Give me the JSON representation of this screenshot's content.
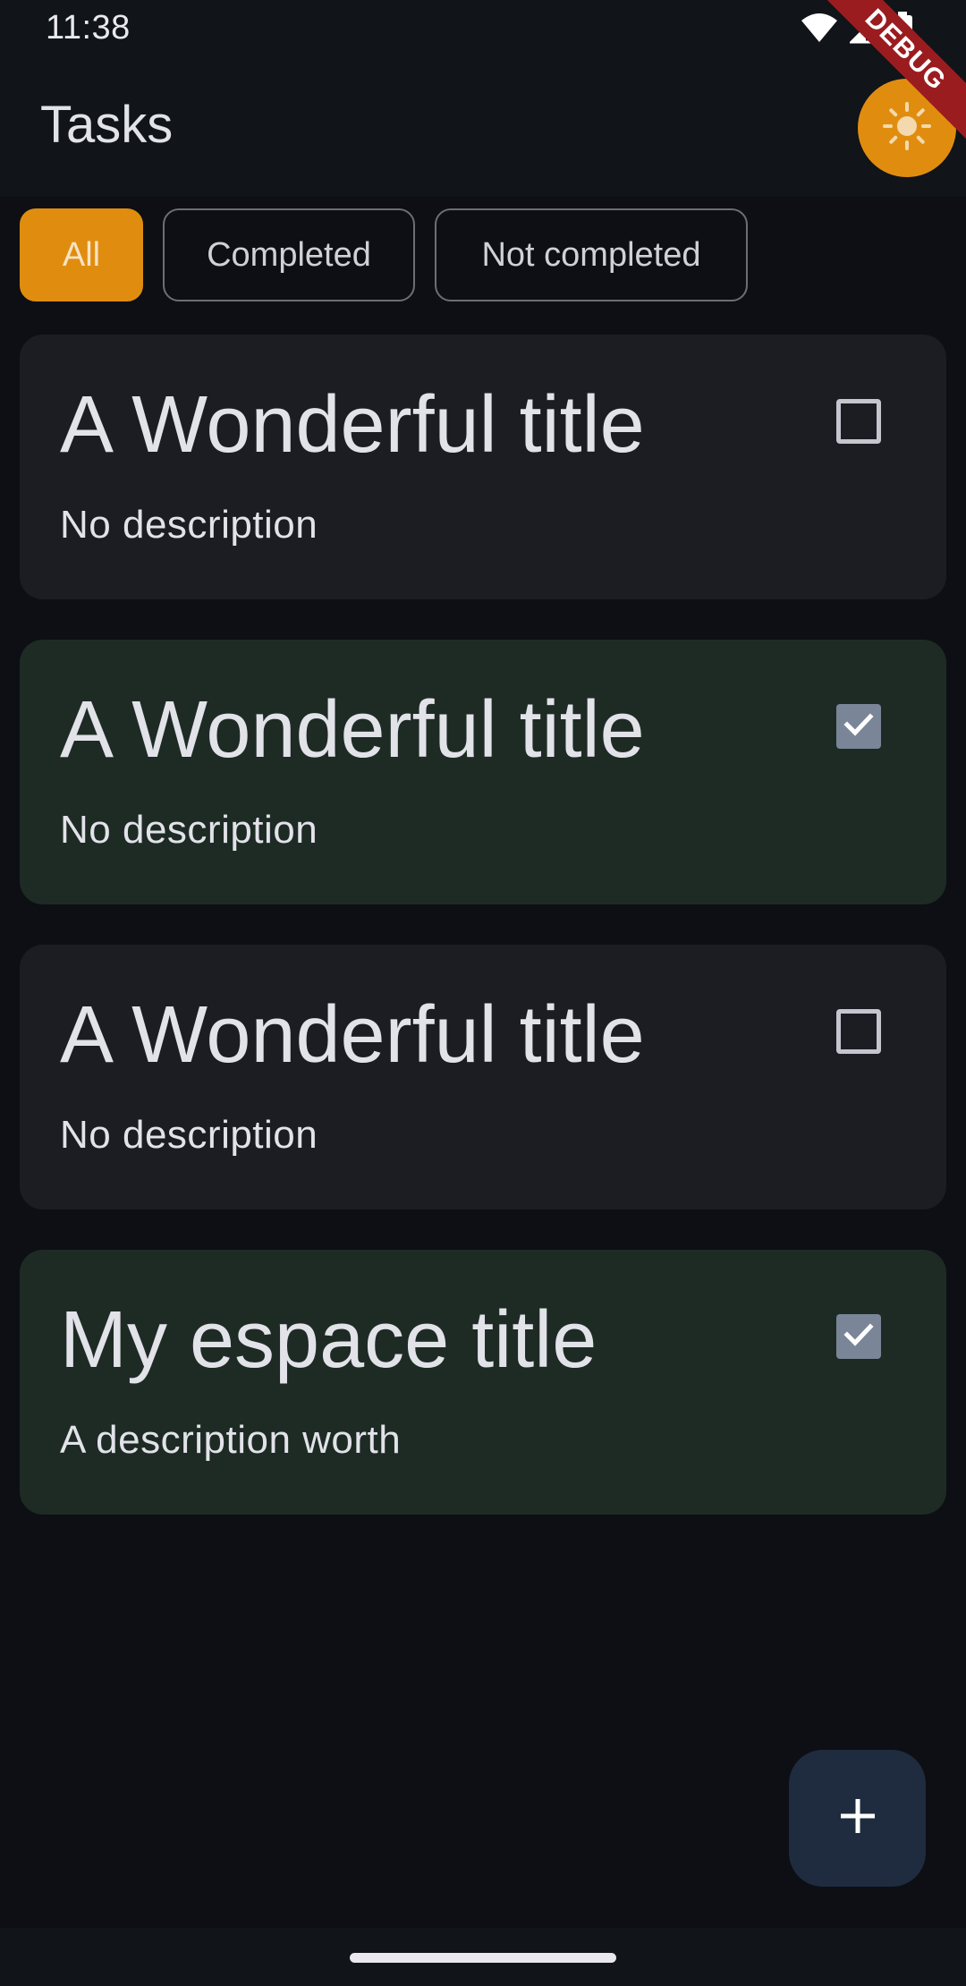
{
  "status_bar": {
    "time": "11:38",
    "icons": [
      "wifi-icon",
      "signal-icon",
      "battery-icon"
    ]
  },
  "debug_banner": {
    "label": "DEBUG"
  },
  "app_bar": {
    "title": "Tasks",
    "theme_toggle_icon": "sun-icon"
  },
  "filters": {
    "items": [
      {
        "label": "All",
        "selected": true
      },
      {
        "label": "Completed",
        "selected": false
      },
      {
        "label": "Not completed",
        "selected": false
      }
    ]
  },
  "tasks": [
    {
      "title": "A Wonderful title",
      "description": "No description",
      "completed": false
    },
    {
      "title": "A Wonderful title",
      "description": "No description",
      "completed": true
    },
    {
      "title": "A Wonderful title",
      "description": "No description",
      "completed": false
    },
    {
      "title": "My espace title",
      "description": "A description worth",
      "completed": true
    }
  ],
  "fab": {
    "icon": "plus-icon"
  },
  "colors": {
    "accent": "#e08d0f",
    "background": "#0d0f14",
    "card": "#1b1d22",
    "card_completed": "#1e2b25",
    "fab": "#1f2b3e"
  }
}
